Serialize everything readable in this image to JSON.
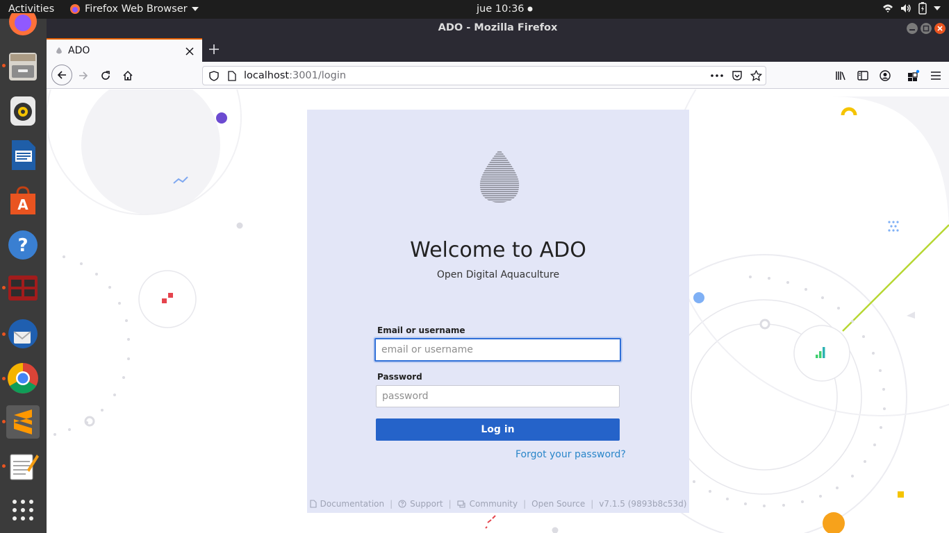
{
  "topbar": {
    "activities": "Activities",
    "app_name": "Firefox Web Browser",
    "clock": "jue 10:36"
  },
  "window": {
    "title": "ADO - Mozilla Firefox"
  },
  "tab": {
    "title": "ADO"
  },
  "address_bar": {
    "host": "localhost",
    "path": ":3001/login"
  },
  "login": {
    "title": "Welcome to ADO",
    "subtitle": "Open Digital Aquaculture",
    "email_label": "Email or username",
    "email_placeholder": "email or username",
    "password_label": "Password",
    "password_placeholder": "password",
    "login_button": "Log in",
    "forgot_link": "Forgot your password?"
  },
  "footer": {
    "documentation": "Documentation",
    "support": "Support",
    "community": "Community",
    "open_source": "Open Source",
    "version": "v7.1.5 (9893b8c53d)",
    "separator": "|"
  },
  "colors": {
    "accent": "#2563c9",
    "card_bg": "#e3e6f7",
    "link": "#2a86c9",
    "dock_bg": "#3b3b3b",
    "topbar_bg": "#1d1d1d"
  }
}
